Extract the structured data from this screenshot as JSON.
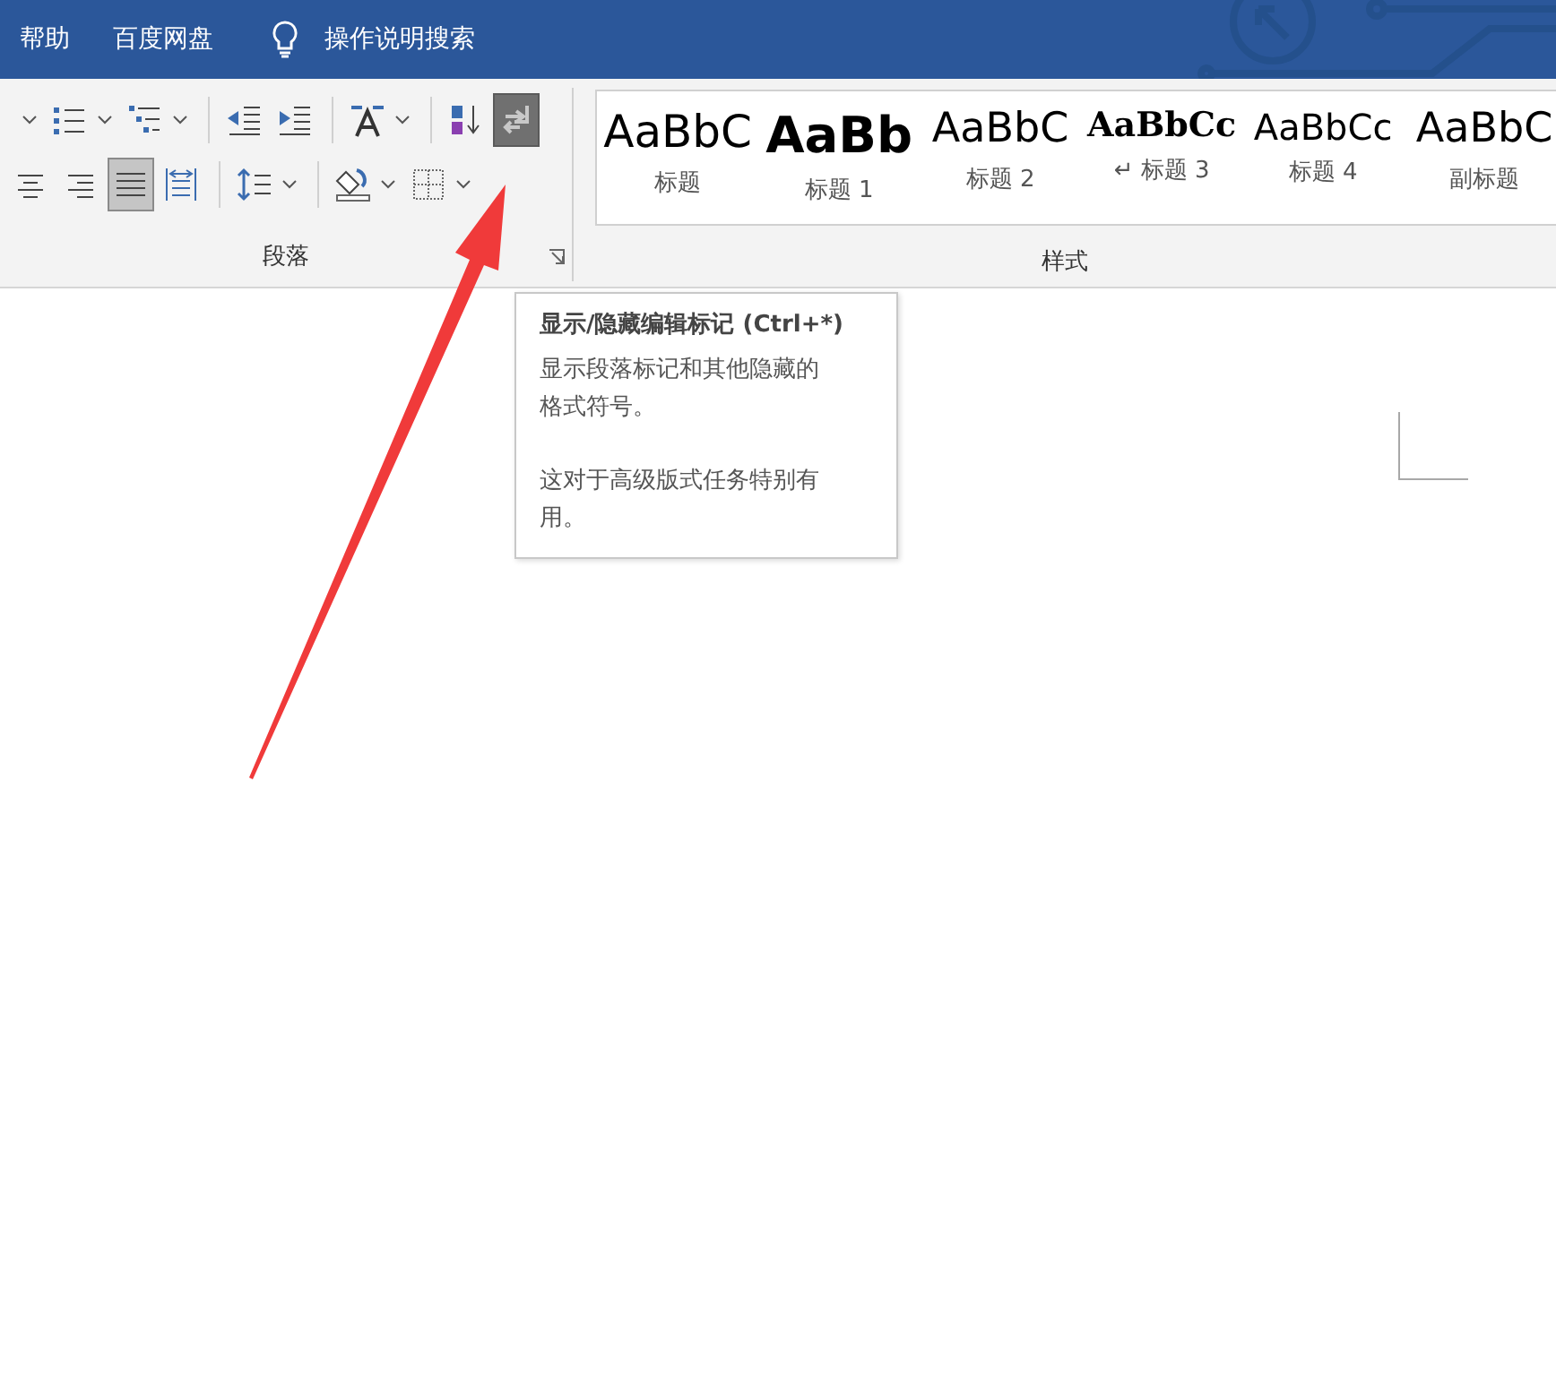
{
  "title_bar": {
    "tabs": [
      "帮助",
      "百度网盘"
    ],
    "tell_me": "操作说明搜索"
  },
  "paragraph_group": {
    "label": "段落",
    "rows": [
      [
        {
          "kind": "caret-only",
          "selected": false
        },
        {
          "kind": "numbering",
          "has_menu": true,
          "selected": false
        },
        {
          "kind": "multilevel",
          "has_menu": true,
          "selected": false
        },
        {
          "kind": "sep"
        },
        {
          "kind": "outdent",
          "selected": false
        },
        {
          "kind": "indent",
          "selected": false
        },
        {
          "kind": "sep"
        },
        {
          "kind": "spacing",
          "has_menu": true,
          "selected": false
        },
        {
          "kind": "sep"
        },
        {
          "kind": "sort",
          "selected": false
        },
        {
          "kind": "marks",
          "selected": true
        }
      ],
      [
        {
          "kind": "center",
          "selected": false
        },
        {
          "kind": "right",
          "selected": false
        },
        {
          "kind": "justify",
          "selected": true
        },
        {
          "kind": "distribute",
          "selected": false
        },
        {
          "kind": "sep"
        },
        {
          "kind": "linespacing",
          "has_menu": true,
          "selected": false
        },
        {
          "kind": "sep"
        },
        {
          "kind": "shading",
          "has_menu": true,
          "selected": false
        },
        {
          "kind": "borders",
          "has_menu": true,
          "selected": false
        }
      ]
    ]
  },
  "styles_group": {
    "label": "样式",
    "styles": [
      {
        "kind": "title",
        "preview": "AaBbC",
        "label": "标题"
      },
      {
        "kind": "h1",
        "preview": "AaBb",
        "label": "标题 1"
      },
      {
        "kind": "h2",
        "preview": "AaBbC",
        "label": "标题 2"
      },
      {
        "kind": "h3",
        "preview": "AaBbCc",
        "label": "↵ 标题 3"
      },
      {
        "kind": "h4",
        "preview": "AaBbCc",
        "label": "标题 4"
      },
      {
        "kind": "subtitle",
        "preview": "AaBbC",
        "label": "副标题"
      }
    ]
  },
  "tooltip": {
    "title": "显示/隐藏编辑标记 (Ctrl+*)",
    "paragraphs": [
      "显示段落标记和其他隐藏的格式符号。",
      "这对于高级版式任务特别有用。"
    ]
  }
}
